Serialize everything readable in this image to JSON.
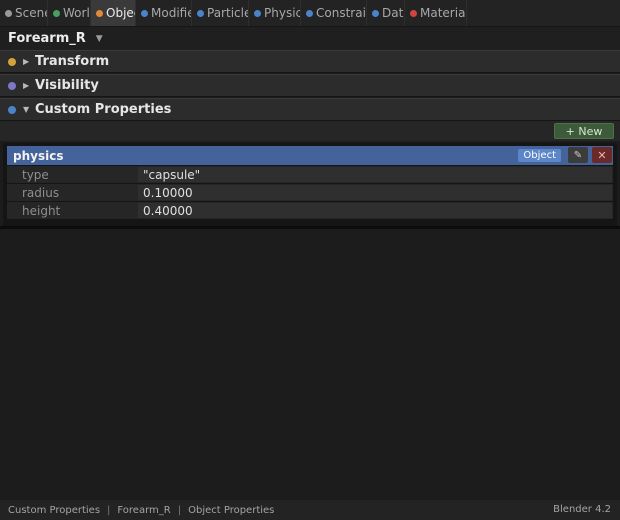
{
  "tabs": [
    {
      "label": "Scene",
      "dot_color": "#9a9a9a",
      "active": false
    },
    {
      "label": "World",
      "dot_color": "#4aa05e",
      "active": false
    },
    {
      "label": "Object",
      "dot_color": "#e08a3a",
      "active": true
    },
    {
      "label": "Modifiers",
      "dot_color": "#4a84c8",
      "active": false
    },
    {
      "label": "Particles",
      "dot_color": "#4a84c8",
      "active": false
    },
    {
      "label": "Physics",
      "dot_color": "#4a84c8",
      "active": false
    },
    {
      "label": "Constraints",
      "dot_color": "#4a84c8",
      "active": false
    },
    {
      "label": "Data",
      "dot_color": "#4a84c8",
      "active": false
    },
    {
      "label": "Material",
      "dot_color": "#d2453e",
      "active": false
    }
  ],
  "object": {
    "name": "Forearm_R",
    "dropdown_icon": "chevron-down-icon"
  },
  "panels": [
    {
      "title": "Transform",
      "dot_color": "#d4a23a",
      "expanded": false
    },
    {
      "title": "Visibility",
      "dot_color": "#7d79c8",
      "expanded": false
    },
    {
      "title": "Custom Properties",
      "dot_color": "#4a84c8",
      "expanded": true
    }
  ],
  "new_button": {
    "label": "+ New"
  },
  "property_group": {
    "title": "physics",
    "badge": "Object",
    "edit_icon": "pencil-icon",
    "delete_icon": "close-icon",
    "rows": [
      {
        "key": "type",
        "value": "\"capsule\""
      },
      {
        "key": "radius",
        "value": "0.10000"
      },
      {
        "key": "height",
        "value": "0.40000"
      }
    ]
  },
  "status": {
    "crumbs": [
      "Custom Properties",
      "Forearm_R",
      "Object Properties"
    ],
    "version": "Blender 4.2"
  }
}
